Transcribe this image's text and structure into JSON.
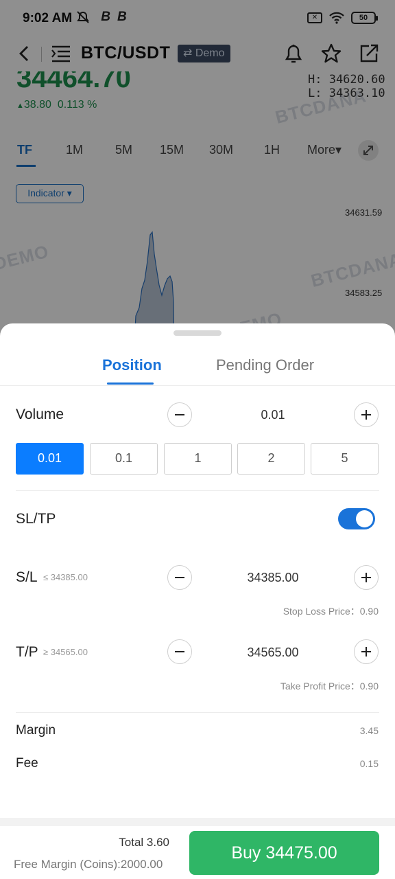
{
  "status_bar": {
    "time": "9:02 AM",
    "battery": "50"
  },
  "header": {
    "pair": "BTC/USDT",
    "demo_label": "⇄ Demo"
  },
  "ticker": {
    "price": "34464.70",
    "change_abs": "38.80",
    "change_pct": "0.113 %",
    "high": "H:  34620.60",
    "low": "L:  34363.10"
  },
  "timeframes": [
    {
      "label": "TF"
    },
    {
      "label": "1M"
    },
    {
      "label": "5M"
    },
    {
      "label": "15M"
    },
    {
      "label": "30M"
    },
    {
      "label": "1H"
    },
    {
      "label": "More▾"
    }
  ],
  "indicator_label": "Indicator ▾",
  "chart_y_labels": [
    "34631.59",
    "34583.25"
  ],
  "watermarks": [
    "DEMO",
    "BTCDANA",
    "BTCDANA",
    "DEMO"
  ],
  "sheet": {
    "tabs": [
      "Position",
      "Pending Order"
    ],
    "volume": {
      "label": "Volume",
      "value": "0.01",
      "options": [
        "0.01",
        "0.1",
        "1",
        "2",
        "5"
      ],
      "selected": "0.01"
    },
    "sltp": {
      "label": "SL/TP",
      "enabled": true
    },
    "sl": {
      "label": "S/L",
      "hint": "≤ 34385.00",
      "value": "34385.00",
      "note": "Stop Loss Price：0.90"
    },
    "tp": {
      "label": "T/P",
      "hint": "≥ 34565.00",
      "value": "34565.00",
      "note": "Take Profit Price：0.90"
    },
    "margin": {
      "label": "Margin",
      "value": "3.45"
    },
    "fee": {
      "label": "Fee",
      "value": "0.15"
    }
  },
  "footer": {
    "total": "Total  3.60",
    "free_margin": "Free Margin (Coins):2000.00",
    "buy_label": "Buy  34475.00"
  },
  "colors": {
    "accent": "#1a73d9",
    "buy": "#2fb666",
    "up": "#1e8f4e"
  }
}
